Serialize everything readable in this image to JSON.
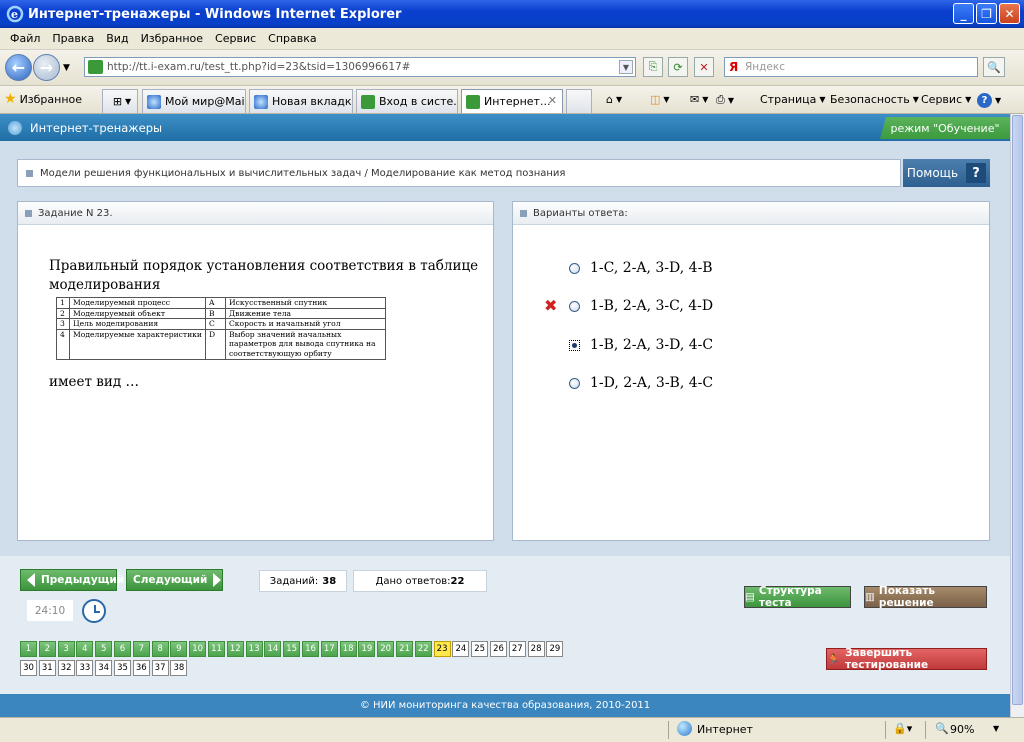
{
  "window": {
    "title": "Интернет-тренажеры - Windows Internet Explorer"
  },
  "menu": [
    "Файл",
    "Правка",
    "Вид",
    "Избранное",
    "Сервис",
    "Справка"
  ],
  "address": {
    "url": "http://tt.i-exam.ru/test_tt.php?id=23&tsid=1306996617#",
    "search_placeholder": "Яндекс"
  },
  "favorites": {
    "label": "Избранное",
    "tabs": [
      {
        "label": "Мой мир@Mai..."
      },
      {
        "label": "Новая вкладка"
      },
      {
        "label": "Вход в систе..."
      },
      {
        "label": "Интернет..."
      }
    ],
    "tools": [
      "Страница",
      "Безопасность",
      "Сервис"
    ]
  },
  "app": {
    "title": "Интернет-тренажеры",
    "mode": "режим \"Обучение\"",
    "breadcrumb": "Модели решения функциональных и вычислительных задач / Моделирование как метод познания",
    "help_label": "Помощь",
    "help_q": "?",
    "task_header": "Задание N 23.",
    "answers_header": "Варианты ответа:",
    "question_line1": "Правильный порядок установления соответствия в таблице",
    "question_line2": "моделирования",
    "question_end": "имеет вид …",
    "table": [
      [
        "1",
        "Моделируемый процесс",
        "A",
        "Искусственный спутник"
      ],
      [
        "2",
        "Моделируемый объект",
        "B",
        "Движение тела"
      ],
      [
        "3",
        "Цель моделирования",
        "C",
        "Скорость и начальный угол"
      ],
      [
        "4",
        "Моделируемые характеристики",
        "D",
        "Выбор значений начальных параметров для вывода спутника на соответствующую орбиту"
      ]
    ],
    "options": [
      {
        "label": "1-C, 2-A, 3-D, 4-B"
      },
      {
        "label": "1-B, 2-A, 3-C, 4-D"
      },
      {
        "label": "1-B, 2-A, 3-D, 4-C"
      },
      {
        "label": "1-D, 2-A, 3-B, 4-C"
      }
    ],
    "wrong_mark": "✖",
    "prev_label": "Предыдущий",
    "next_label": "Следующий",
    "tasks_label": "Заданий:",
    "tasks_count": "38",
    "answered_label": "Дано ответов:",
    "answered_count": "22",
    "timer": "24:10",
    "structure_label": "Структура теста",
    "solution_label": "Показать решение",
    "finish_label": "Завершить тестирование",
    "question_numbers": [
      "1",
      "2",
      "3",
      "4",
      "5",
      "6",
      "7",
      "8",
      "9",
      "10",
      "11",
      "12",
      "13",
      "14",
      "15",
      "16",
      "17",
      "18",
      "19",
      "20",
      "21",
      "22",
      "23",
      "24",
      "25",
      "26",
      "27",
      "28",
      "29",
      "30",
      "31",
      "32",
      "33",
      "34",
      "35",
      "36",
      "37",
      "38"
    ],
    "copyright": "© НИИ мониторинга качества образования, 2010-2011"
  },
  "status": {
    "zone": "Интернет",
    "zoom": "90%"
  },
  "colors": {
    "accent_green": "#4ca44c",
    "accent_blue": "#3b86be",
    "current_yellow": "#ffe84d",
    "finish_red": "#c03a3a"
  }
}
